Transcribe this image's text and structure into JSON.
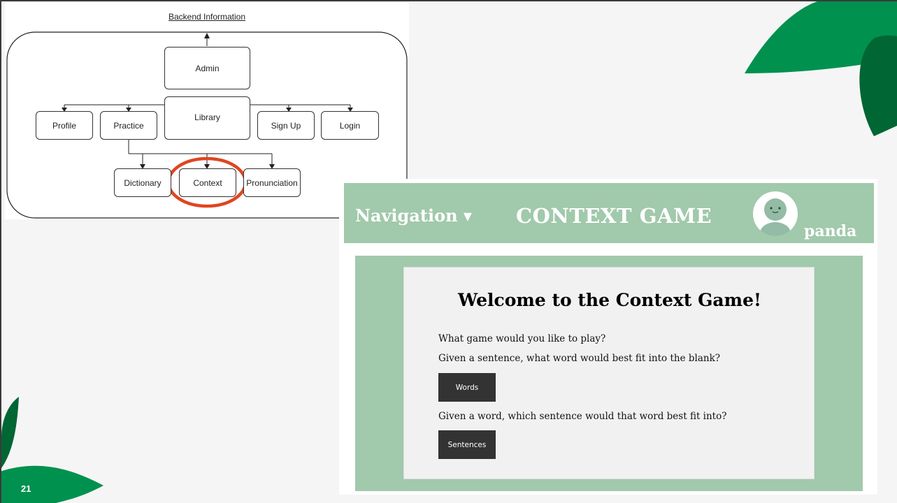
{
  "slide": {
    "page_number": "21",
    "colors": {
      "background": "#f5f5f5",
      "leaf_green": "#00914f",
      "leaf_dark": "#006633"
    }
  },
  "diagram": {
    "title": "Backend Information",
    "nodes": {
      "admin": "Admin",
      "library": "Library",
      "profile": "Profile",
      "practice": "Practice",
      "signup": "Sign Up",
      "login": "Login",
      "dictionary": "Dictionary",
      "context": "Context",
      "pronunciation": "Pronunciation"
    },
    "highlight_color": "#e0451f"
  },
  "app": {
    "header": {
      "navigation_label": "Navigation ▾",
      "title": "CONTEXT GAME",
      "username": "panda",
      "avatar_icon": "user-avatar-icon"
    },
    "main": {
      "heading": "Welcome to the Context Game!",
      "question": "What game would you like to play?",
      "option1_text": "Given a sentence, what word would best fit into the blank?",
      "option1_button": "Words",
      "option2_text": "Given a word, which sentence would that word best fit into?",
      "option2_button": "Sentences"
    },
    "colors": {
      "header_bg": "#a1c9ab",
      "card_bg": "#f1f1f1",
      "button_bg": "#333333"
    }
  }
}
